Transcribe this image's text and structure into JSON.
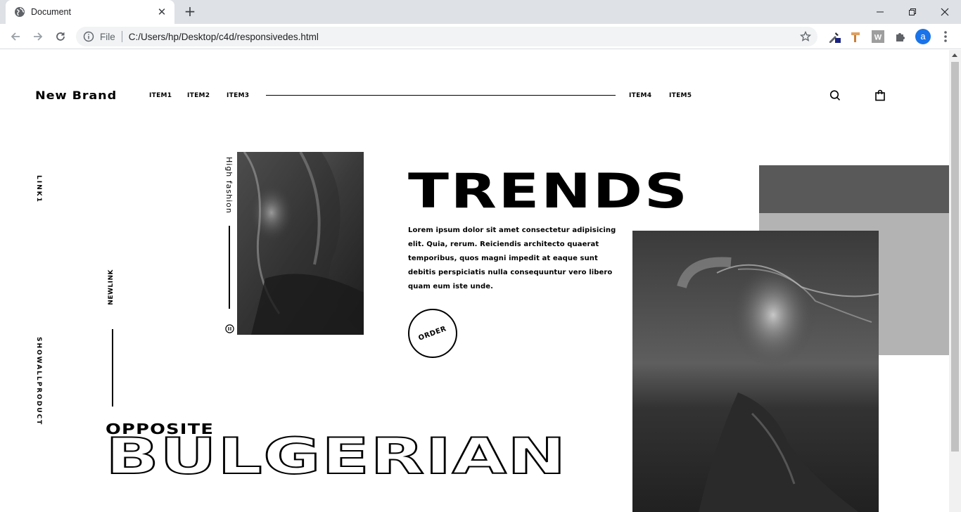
{
  "browser": {
    "tab_title": "Document",
    "new_tab_label": "+",
    "omnibox": {
      "scheme_label": "File",
      "url": "C:/Users/hp/Desktop/c4d/responsivedes.html"
    },
    "profile_initial": "a",
    "window_controls": [
      "minimize",
      "restore",
      "close"
    ],
    "icons": [
      "globe-icon",
      "back-icon",
      "forward-icon",
      "reload-icon",
      "info-icon",
      "star-icon",
      "eyedropper-icon",
      "hammer-icon",
      "w-icon",
      "puzzle-icon",
      "kebab-icon"
    ]
  },
  "page": {
    "brand": "New Brand",
    "nav_left": [
      "ITEM1",
      "ITEM2",
      "ITEM3"
    ],
    "nav_right": [
      "ITEM4",
      "ITEM5"
    ],
    "header_icons": [
      "search-icon",
      "bag-icon"
    ],
    "side_links": {
      "link1": "LINK1",
      "newlink": "NEWLINK",
      "show_all": "SHOWALLPRODUCT"
    },
    "high_fashion": "High fashion",
    "hero_title": "TRENDS",
    "hero_body": "Lorem ipsum dolor sit amet consectetur adipisicing elit. Quia, rerum. Reiciendis architecto quaerat temporibus, quos magni impedit at eaque sunt debitis perspiciatis nulla consequuntur vero libero quam eum iste unde.",
    "order_label": "ORDER",
    "opposite": "OPPOSITE",
    "bulgerian": "BULGERIAN"
  },
  "colors": {
    "text": "#000000",
    "gray_dark": "#595959",
    "gray_light": "#b3b3b3",
    "chrome_tabstrip": "#dee1e6",
    "omnibox_bg": "#f1f3f4",
    "avatar_blue": "#1a73e8"
  }
}
